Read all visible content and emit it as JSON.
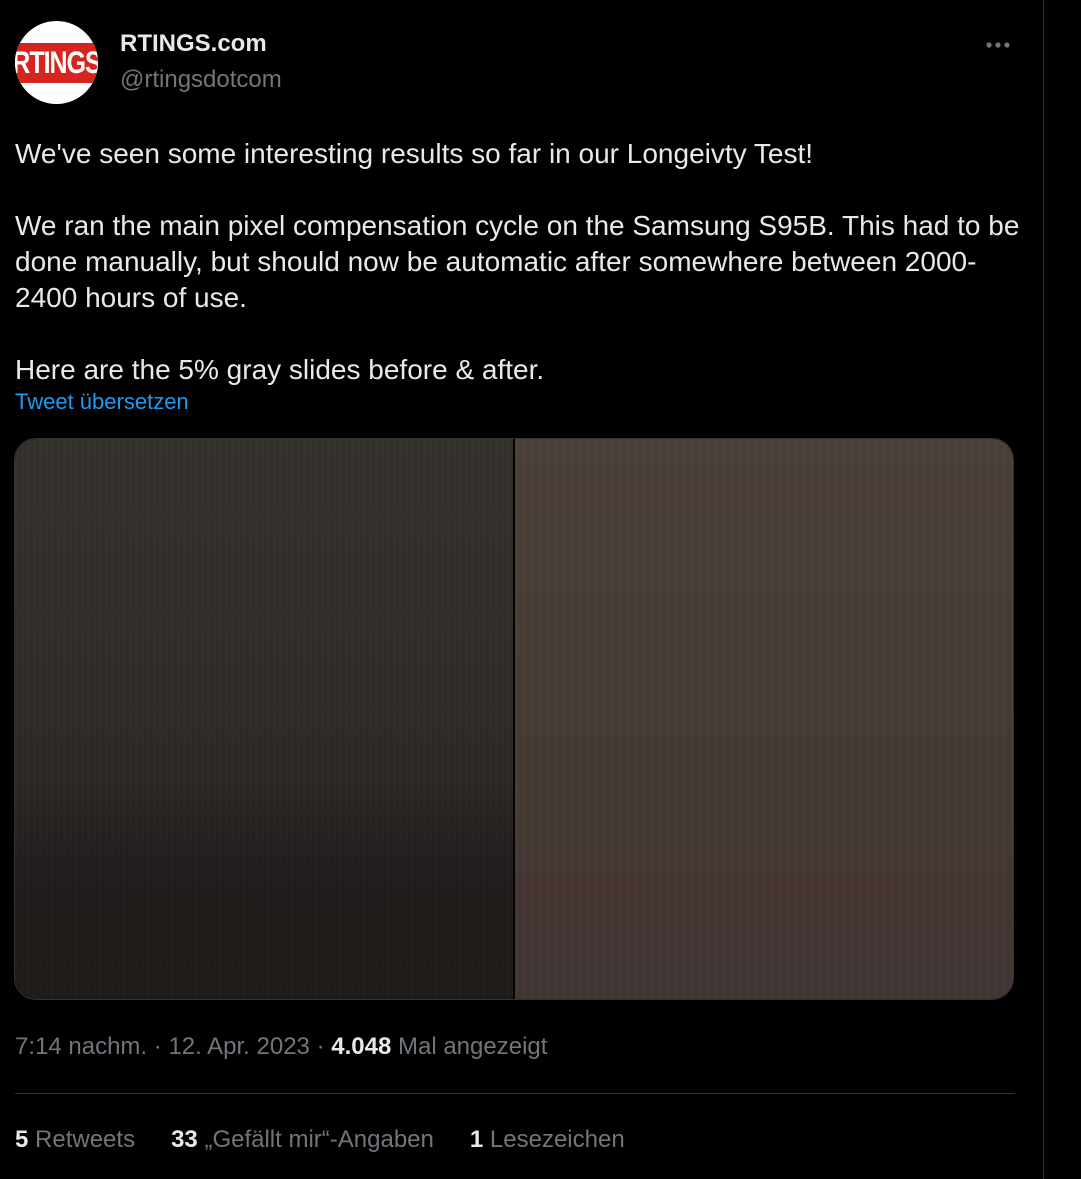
{
  "author": {
    "display_name": "RTINGS.com",
    "handle": "@rtingsdotcom",
    "avatar_logo_text": "RTINGS"
  },
  "tweet": {
    "paragraphs": [
      "We've seen some interesting results so far in our Longeivty Test!",
      "We ran the main pixel compensation cycle on the Samsung S95B. This had to be done manually, but should now be automatic after somewhere between 2000-2400 hours of use.",
      "Here are the 5% gray slides before & after."
    ],
    "translate_label": "Tweet übersetzen"
  },
  "media": {
    "images": [
      "before-gray-slide",
      "after-gray-slide"
    ]
  },
  "meta": {
    "time": "7:14 nachm.",
    "separator": "·",
    "date": "12. Apr. 2023",
    "views_count": "4.048",
    "views_label": "Mal angezeigt"
  },
  "stats": {
    "retweets_count": "5",
    "retweets_label": "Retweets",
    "likes_count": "33",
    "likes_label": "„Gefällt mir“-Angaben",
    "bookmarks_count": "1",
    "bookmarks_label": "Lesezeichen"
  },
  "icons": {
    "more": "more-horizontal-icon"
  },
  "colors": {
    "background": "#000000",
    "text_primary": "#e7e9ea",
    "text_secondary": "#71767b",
    "link": "#1d9bf0",
    "border": "#2f3336",
    "logo_red": "#d6241f"
  }
}
